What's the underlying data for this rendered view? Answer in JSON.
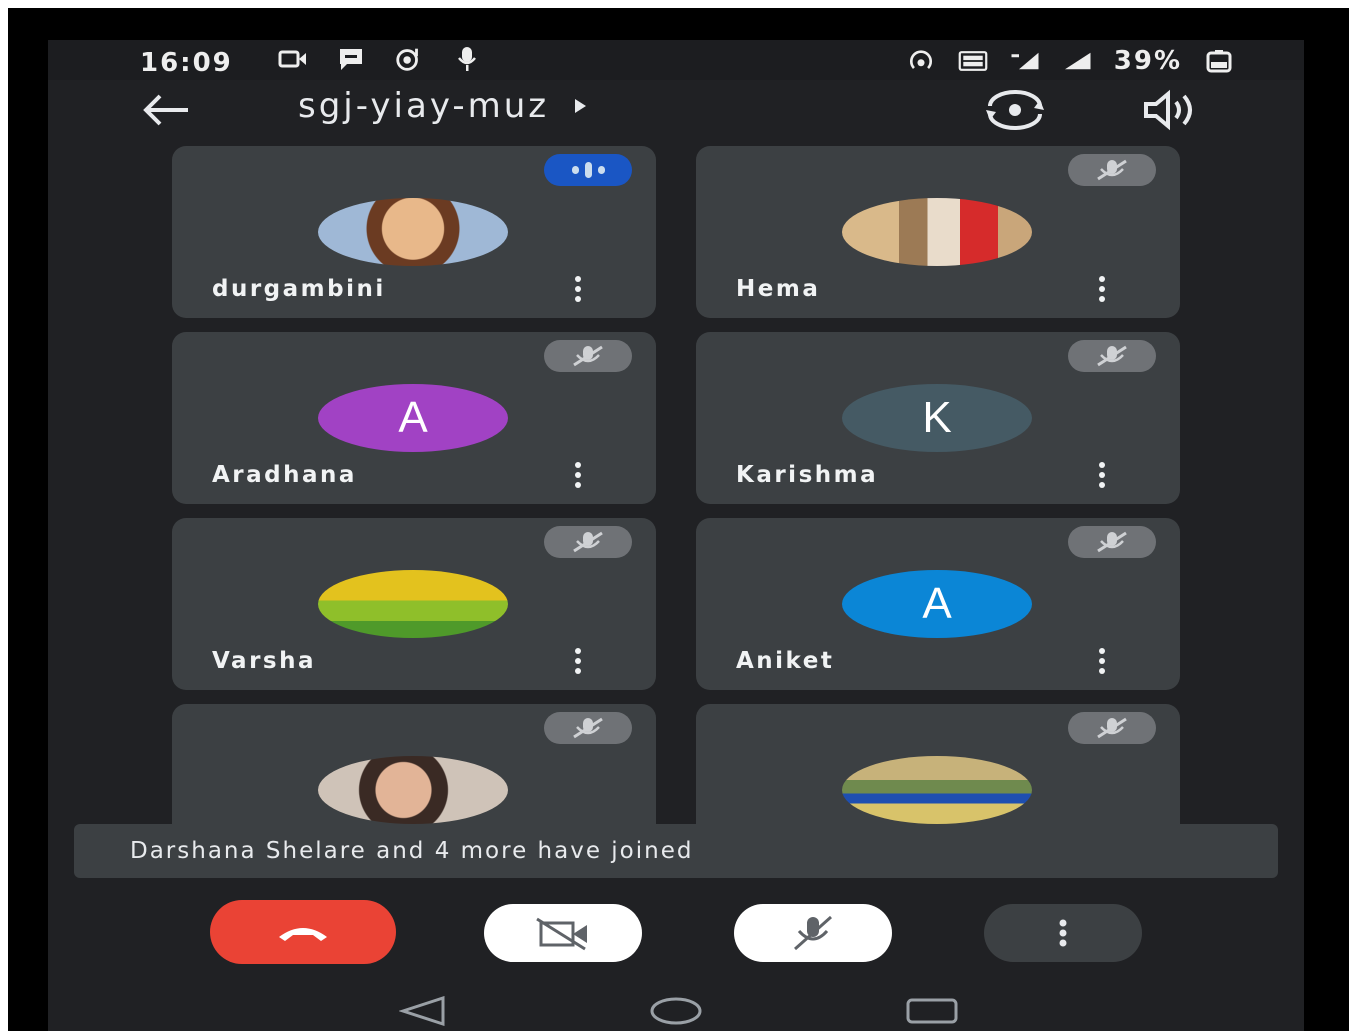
{
  "status_bar": {
    "time": "16:09",
    "battery": "39%",
    "icons_left": [
      "video-cam-icon",
      "chat-bubble-icon",
      "music-disc-icon",
      "microphone-icon"
    ],
    "icons_right": [
      "hotspot-icon",
      "volte-icon",
      "signal-4g-icon",
      "signal-icon",
      "battery-icon"
    ]
  },
  "toolbar": {
    "meeting_code": "sgj-yiay-muz"
  },
  "participants": [
    {
      "name": "durgambini",
      "avatar_type": "photo",
      "avatar_color": "#b88a5a",
      "status": "speaking"
    },
    {
      "name": "Hema",
      "avatar_type": "photo",
      "avatar_color": "#caa67c",
      "status": "muted"
    },
    {
      "name": "Aradhana",
      "avatar_type": "initial",
      "initial": "A",
      "avatar_color": "#a142c4",
      "status": "muted"
    },
    {
      "name": "Karishma",
      "avatar_type": "initial",
      "initial": "K",
      "avatar_color": "#455a64",
      "status": "muted"
    },
    {
      "name": "Varsha",
      "avatar_type": "photo",
      "avatar_color": "#9cbf2a",
      "status": "muted"
    },
    {
      "name": "Aniket",
      "avatar_type": "initial",
      "initial": "A",
      "avatar_color": "#0b86d6",
      "status": "muted"
    },
    {
      "name": "",
      "avatar_type": "photo",
      "avatar_color": "#8a6b55",
      "status": "muted"
    },
    {
      "name": "",
      "avatar_type": "photo",
      "avatar_color": "#7b8a5e",
      "status": "muted"
    }
  ],
  "toast": {
    "message": "Darshana Shelare and 4 more have joined"
  },
  "controls": {
    "colors": {
      "end_call": "#ea4335",
      "toggle_bg": "#ffffff",
      "more_bg": "#3c4043"
    }
  }
}
